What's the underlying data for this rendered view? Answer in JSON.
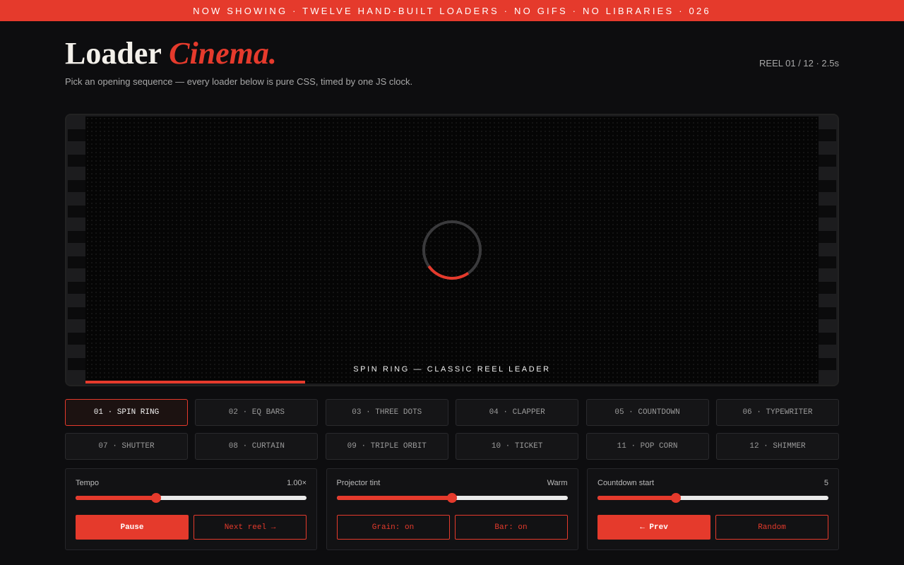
{
  "ticker": "NOW SHOWING · TWELVE HAND-BUILT LOADERS · NO GIFS · NO LIBRARIES · 026",
  "header": {
    "title_main": "Loader",
    "title_accent": "Cinema.",
    "subtitle": "Pick an opening sequence — every loader below is pure CSS, timed by one JS clock.",
    "reel_info": "REEL 01 / 12 · 2.5s"
  },
  "screen": {
    "caption": "SPIN RING — CLASSIC REEL LEADER",
    "progress": 0.3
  },
  "reels": [
    "01 · SPIN RING",
    "02 · EQ BARS",
    "03 · THREE DOTS",
    "04 · CLAPPER",
    "05 · COUNTDOWN",
    "06 · TYPEWRITER",
    "07 · SHUTTER",
    "08 · CURTAIN",
    "09 · TRIPLE ORBIT",
    "10 · TICKET",
    "11 · POP CORN",
    "12 · SHIMMER"
  ],
  "active_reel": 0,
  "controls": {
    "tempo": {
      "label": "Tempo",
      "value": "1.00×",
      "level": 0.35,
      "pause": "Pause",
      "next": "Next reel →"
    },
    "tint": {
      "label": "Projector tint",
      "value": "Warm",
      "level": 0.5,
      "grain": "Grain: on",
      "bar": "Bar: on"
    },
    "countdown": {
      "label": "Countdown start",
      "value": "5",
      "level": 0.34,
      "prev": "← Prev",
      "random": "Random"
    }
  },
  "colors": {
    "accent": "#e53a2c",
    "background": "#0d0d0f"
  }
}
